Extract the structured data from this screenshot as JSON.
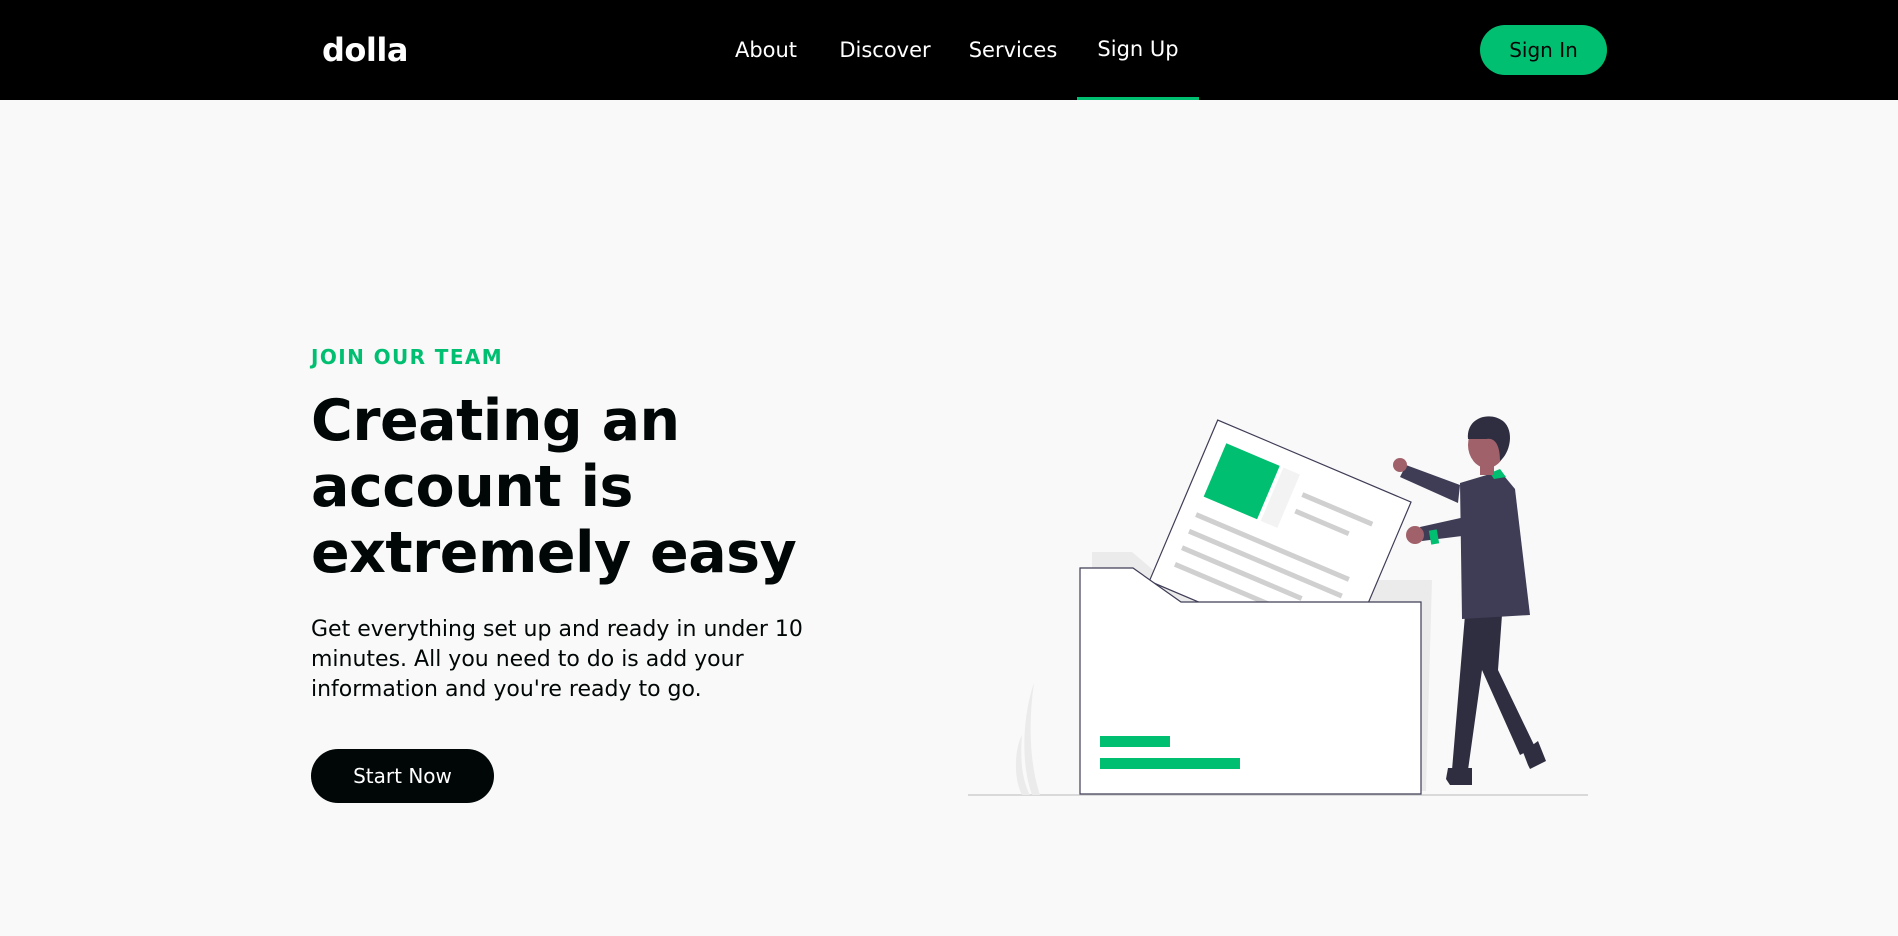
{
  "navbar": {
    "logo": "dolla",
    "links": [
      {
        "label": "About"
      },
      {
        "label": "Discover"
      },
      {
        "label": "Services"
      },
      {
        "label": "Sign Up",
        "active": true
      }
    ],
    "signin_label": "Sign In"
  },
  "hero": {
    "topline": "JOIN OUR TEAM",
    "headline": "Creating an account is extremely easy",
    "subtitle": "Get everything set up and ready in under 10 minutes. All you need to do is add your information and you're ready to go.",
    "button_label": "Start Now"
  },
  "illustration": {
    "description_icon": "person-filing-document-illustration"
  },
  "colors": {
    "nav_bg": "#000000",
    "accent": "#01bf71",
    "page_bg": "#f9f9f9",
    "text_dark": "#010606",
    "figure_dark": "#3f3d56"
  }
}
